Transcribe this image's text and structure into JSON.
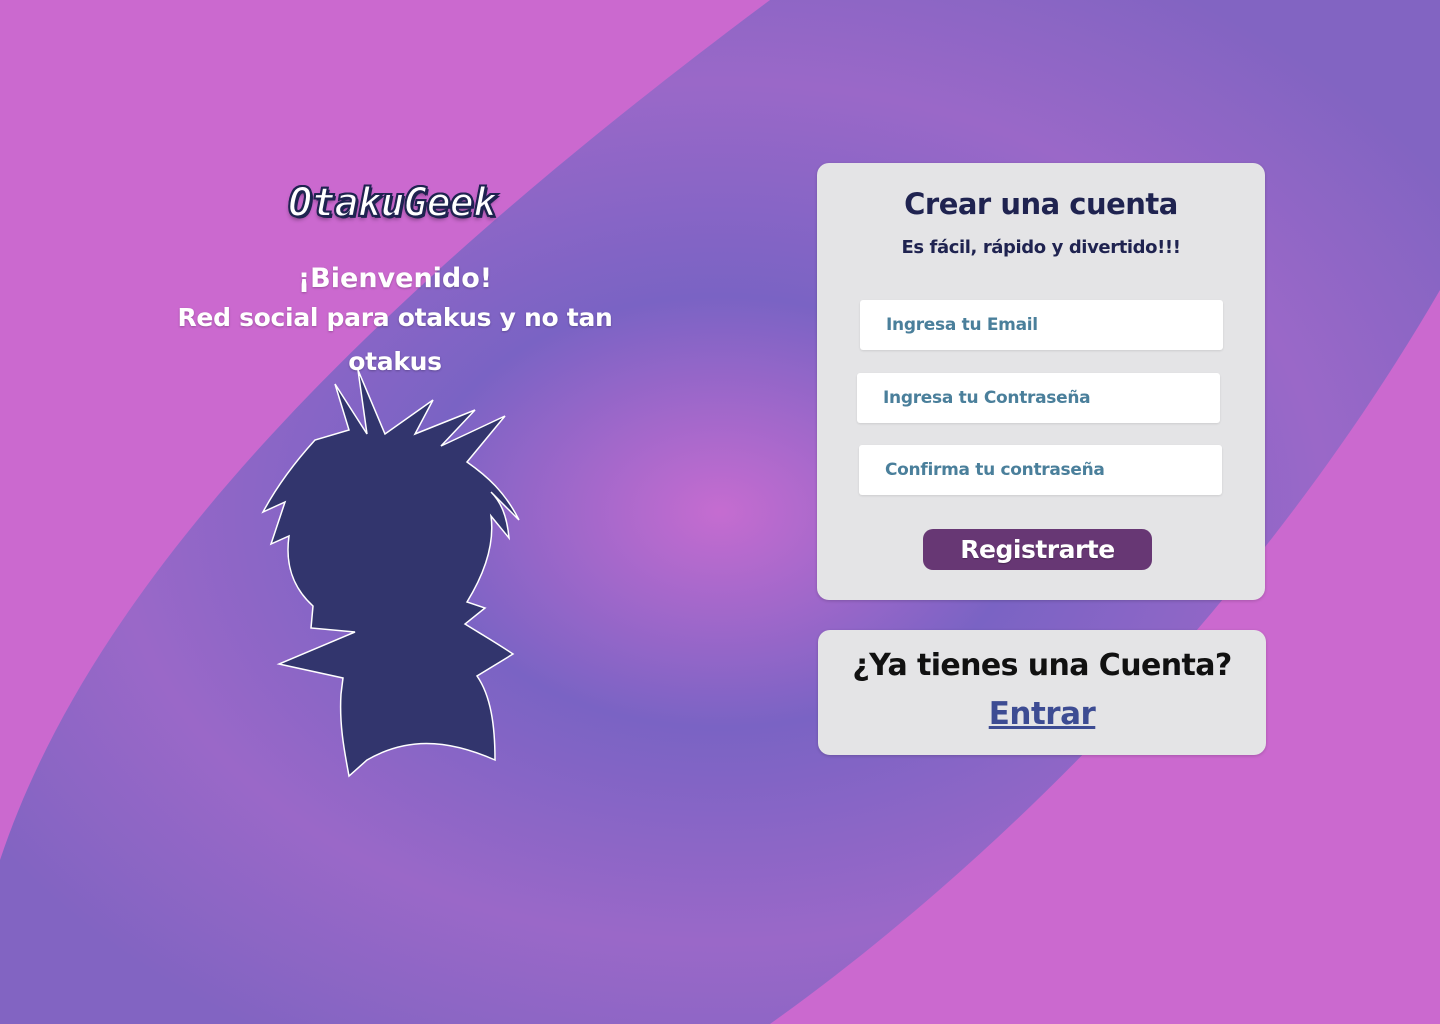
{
  "brand": {
    "logo_text": "OtakuGeek"
  },
  "hero": {
    "greeting": "¡Bienvenido!",
    "tagline": "Red social para otakus y no tan otakus",
    "illustration": "anime-character-silhouette"
  },
  "register_card": {
    "title": "Crear una cuenta",
    "subtitle": "Es fácil, rápido y divertido!!!",
    "email_placeholder": "Ingresa tu Email",
    "password_placeholder": "Ingresa tu Contraseña",
    "confirm_placeholder": "Confirma tu contraseña",
    "submit_label": "Registrarte"
  },
  "login_card": {
    "question": "¿Ya tienes una Cuenta?",
    "link_label": "Entrar"
  },
  "colors": {
    "background_pink": "#cb69cf",
    "band_purple": "#7c62c4",
    "card_bg": "#e4e4e6",
    "title_navy": "#1f2350",
    "input_text": "#4a7f9b",
    "button_purple": "#673774",
    "link_blue": "#3d4c93",
    "silhouette": "#32356d"
  }
}
